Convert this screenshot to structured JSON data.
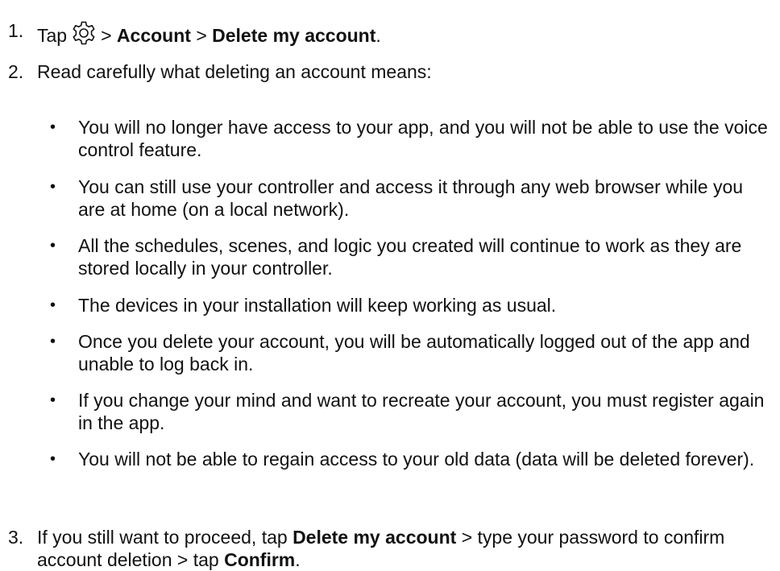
{
  "step1": {
    "number": "1.",
    "text_before": "Tap",
    "icon": "gear-icon",
    "sep1": ">",
    "bold1": "Account",
    "sep2": ">",
    "bold2": "Delete my account",
    "end": "."
  },
  "step2": {
    "number": "2.",
    "text": "Read carefully what deleting an account means:"
  },
  "bullets": [
    "You will no longer have access to your app, and you will not be able to use the voice control feature.",
    "You can still use your controller and access it through any web browser while you are at home (on a local network).",
    "All the schedules, scenes, and logic you created will continue to work as they are stored locally in your controller.",
    "The devices in your installation will keep working as usual.",
    "Once you delete your account, you will be automatically logged out of the app and unable to log back in.",
    "If you change your mind and want to recreate your account, you must register again in the app.",
    "You will not be able to regain access to your old data (data will be deleted forever)."
  ],
  "bullet_symbol": "•",
  "step3": {
    "number": "3.",
    "text1": "If you still want to proceed, tap",
    "bold1": "Delete my account",
    "text2": "> type your password to confirm account deletion > tap",
    "bold2": "Confirm",
    "end": "."
  }
}
